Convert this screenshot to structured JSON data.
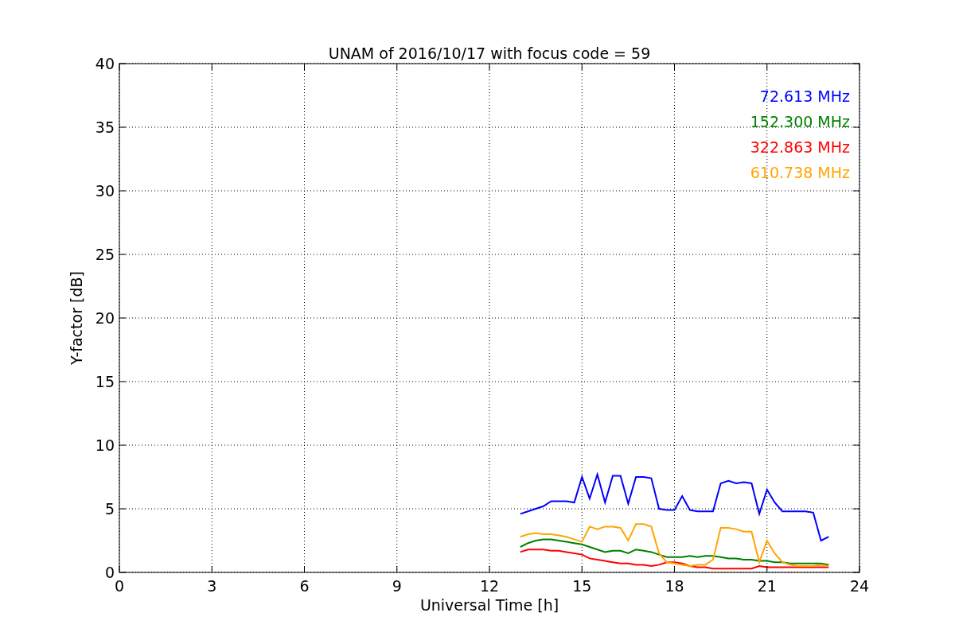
{
  "chart_data": {
    "type": "line",
    "title": "UNAM of 2016/10/17 with focus code = 59",
    "xlabel": "Universal Time [h]",
    "ylabel": "Y-factor [dB]",
    "x": [
      13,
      13.25,
      13.5,
      13.75,
      14,
      14.25,
      14.5,
      14.75,
      15,
      15.25,
      15.5,
      15.75,
      16,
      16.25,
      16.5,
      16.75,
      17,
      17.25,
      17.5,
      17.75,
      18,
      18.25,
      18.5,
      18.75,
      19,
      19.25,
      19.5,
      19.75,
      20,
      20.25,
      20.5,
      20.75,
      21,
      21.25,
      21.5,
      21.75,
      22,
      22.25,
      22.5,
      22.75,
      23
    ],
    "series": [
      {
        "name": "72.613 MHz",
        "color": "#0000ff",
        "values": [
          4.6,
          4.8,
          5.0,
          5.2,
          5.6,
          5.6,
          5.6,
          5.5,
          7.5,
          5.8,
          7.7,
          5.5,
          7.6,
          7.6,
          5.4,
          7.5,
          7.5,
          7.4,
          5.0,
          4.9,
          4.9,
          6.0,
          4.9,
          4.8,
          4.8,
          4.8,
          7.0,
          7.2,
          7.0,
          7.1,
          7.0,
          4.6,
          6.5,
          5.5,
          4.8,
          4.8,
          4.8,
          4.8,
          4.7,
          2.5,
          2.8
        ]
      },
      {
        "name": "152.300 MHz",
        "color": "#008000",
        "values": [
          2.0,
          2.3,
          2.5,
          2.6,
          2.6,
          2.5,
          2.4,
          2.3,
          2.2,
          2.0,
          1.8,
          1.6,
          1.7,
          1.7,
          1.5,
          1.8,
          1.7,
          1.6,
          1.4,
          1.2,
          1.2,
          1.2,
          1.3,
          1.2,
          1.3,
          1.3,
          1.2,
          1.1,
          1.1,
          1.0,
          1.0,
          0.9,
          0.9,
          0.8,
          0.8,
          0.7,
          0.7,
          0.7,
          0.7,
          0.7,
          0.6
        ]
      },
      {
        "name": "322.863 MHz",
        "color": "#ff0000",
        "values": [
          1.6,
          1.8,
          1.8,
          1.8,
          1.7,
          1.7,
          1.6,
          1.5,
          1.4,
          1.1,
          1.0,
          0.9,
          0.8,
          0.7,
          0.7,
          0.6,
          0.6,
          0.5,
          0.6,
          0.8,
          0.8,
          0.7,
          0.5,
          0.4,
          0.4,
          0.3,
          0.3,
          0.3,
          0.3,
          0.3,
          0.3,
          0.5,
          0.4,
          0.4,
          0.4,
          0.4,
          0.4,
          0.4,
          0.4,
          0.4,
          0.4
        ]
      },
      {
        "name": "610.738 MHz",
        "color": "#ffa500",
        "values": [
          2.8,
          3.0,
          3.1,
          3.0,
          3.0,
          2.9,
          2.8,
          2.6,
          2.4,
          3.6,
          3.4,
          3.6,
          3.6,
          3.5,
          2.5,
          3.8,
          3.8,
          3.6,
          1.5,
          0.8,
          0.7,
          0.6,
          0.5,
          0.6,
          0.6,
          1.0,
          3.5,
          3.5,
          3.4,
          3.2,
          3.2,
          0.8,
          2.5,
          1.5,
          0.8,
          0.6,
          0.5,
          0.5,
          0.5,
          0.6,
          0.5
        ]
      }
    ],
    "grid": true,
    "xlim": [
      0,
      24
    ],
    "ylim": [
      0,
      40
    ],
    "xticks": [
      0,
      3,
      6,
      9,
      12,
      15,
      18,
      21,
      24
    ],
    "yticks": [
      0,
      5,
      10,
      15,
      20,
      25,
      30,
      35,
      40
    ]
  }
}
